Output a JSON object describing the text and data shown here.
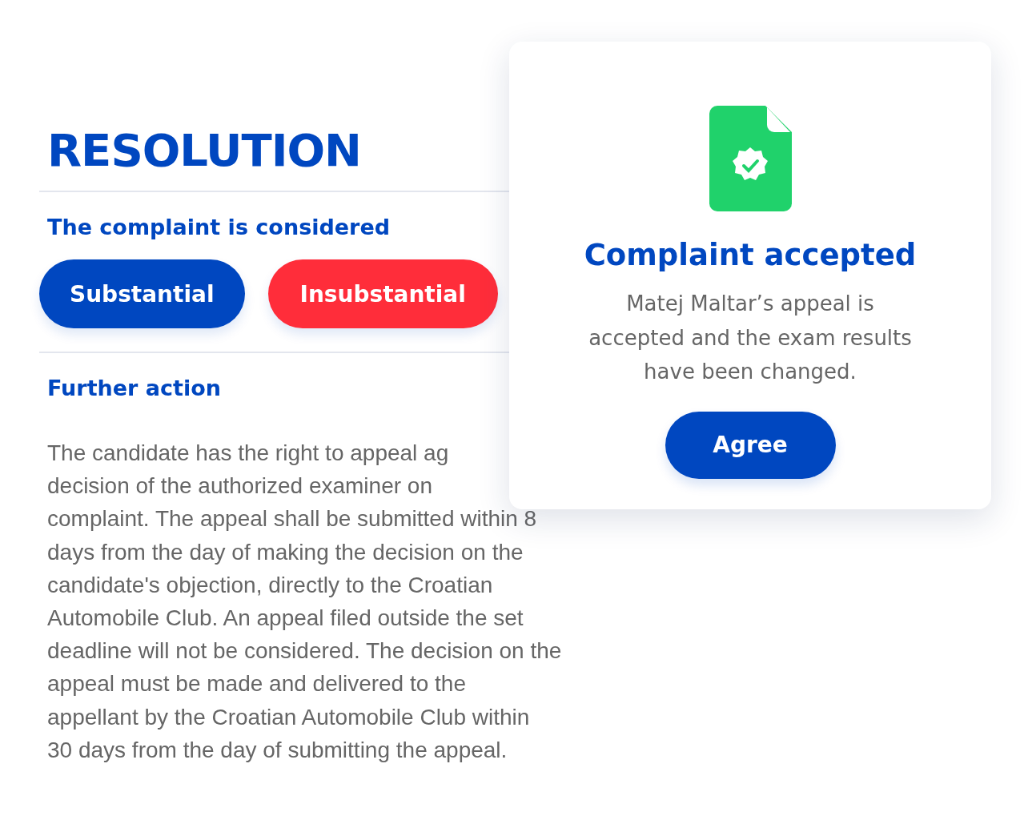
{
  "resolution": {
    "title": "RESOLUTION",
    "question": "The complaint is considered",
    "options": [
      {
        "label": "Substantial",
        "kind": "positive"
      },
      {
        "label": "Insubstantial",
        "kind": "negative"
      }
    ],
    "further_action": {
      "heading": "Further action",
      "lines": [
        "The candidate has the right to appeal ag",
        "decision of the authorized examiner on",
        "complaint. The appeal shall be submitted within 8",
        "days from the day of making the decision on the",
        "candidate's objection, directly to the Croatian",
        "Automobile Club. An appeal filed outside the set",
        "deadline will not be considered. The decision on the",
        "appeal must be made and delivered to the",
        "appellant by the Croatian Automobile Club within",
        "30 days from the day of submitting the appeal."
      ]
    }
  },
  "dialog": {
    "title": "Complaint accepted",
    "message": "Matej Maltar’s appeal is accepted and the exam results have been changed.",
    "button": "Agree"
  }
}
